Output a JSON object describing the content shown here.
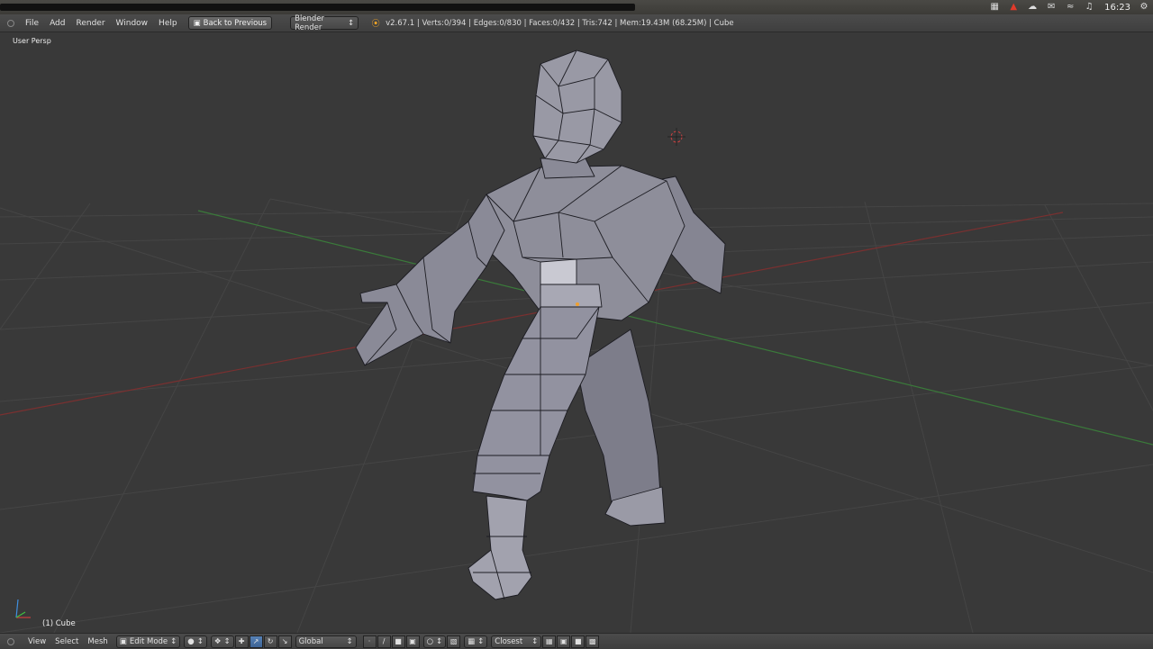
{
  "os_panel": {
    "clock": "16:23",
    "tray_icons": [
      "calendar-icon",
      "alert-icon",
      "cloud-icon",
      "mail-icon",
      "wifi-icon",
      "volume-icon",
      "settings-gear-icon"
    ]
  },
  "info_header": {
    "menus": [
      "File",
      "Add",
      "Render",
      "Window",
      "Help"
    ],
    "back_button": "Back to Previous",
    "render_engine": "Blender Render",
    "stats": "v2.67.1 | Verts:0/394 | Edges:0/830 | Faces:0/432 | Tris:742 | Mem:19.43M (68.25M) | Cube"
  },
  "viewport": {
    "view_label": "User Persp",
    "object_label": "(1) Cube"
  },
  "view_header": {
    "menus": [
      "View",
      "Select",
      "Mesh"
    ],
    "mode": "Edit Mode",
    "orientation": "Global",
    "snap_target": "Closest"
  },
  "colors": {
    "viewport_bg": "#393939",
    "grid_line": "#4a4a4a",
    "x_axis": "#8a3030",
    "y_axis": "#3f8a3f",
    "mesh_face": "#8e8e9a",
    "mesh_edge": "#1c1c22"
  }
}
